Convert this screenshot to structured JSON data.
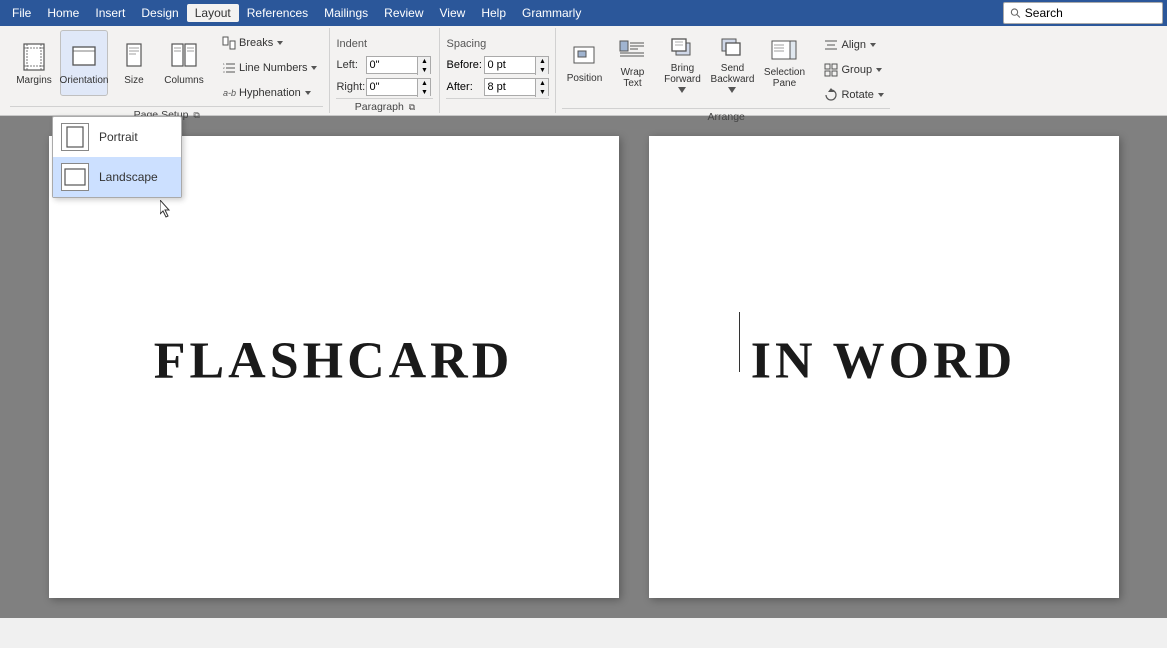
{
  "menubar": {
    "items": [
      "File",
      "Home",
      "Insert",
      "Design",
      "Layout",
      "References",
      "Mailings",
      "Review",
      "View",
      "Help",
      "Grammarly"
    ],
    "active": "Layout",
    "search_placeholder": "Search"
  },
  "ribbon": {
    "groups": [
      {
        "name": "Page Setup",
        "buttons": [
          {
            "id": "margins",
            "label": "Margins",
            "icon": "margins-icon"
          },
          {
            "id": "orientation",
            "label": "Orientation",
            "icon": "orientation-icon"
          },
          {
            "id": "size",
            "label": "Size",
            "icon": "size-icon"
          },
          {
            "id": "columns",
            "label": "Columns",
            "icon": "columns-icon"
          }
        ],
        "small_buttons": [
          {
            "id": "breaks",
            "label": "Breaks",
            "arrow": true
          },
          {
            "id": "line-numbers",
            "label": "Line Numbers",
            "arrow": true
          },
          {
            "id": "hyphenation",
            "label": "Hyphenation",
            "arrow": true
          }
        ]
      },
      {
        "name": "Indent",
        "fields": [
          {
            "label": "Left:",
            "value": "0\""
          },
          {
            "label": "Right:",
            "value": "0\""
          }
        ]
      },
      {
        "name": "Spacing",
        "fields": [
          {
            "label": "Before:",
            "value": "0 pt"
          },
          {
            "label": "After:",
            "value": "8 pt"
          }
        ]
      },
      {
        "name": "Arrange",
        "buttons": [
          {
            "id": "position",
            "label": "Position",
            "icon": "position-icon"
          },
          {
            "id": "wrap-text",
            "label": "Wrap\nText",
            "icon": "wrap-text-icon"
          },
          {
            "id": "bring-forward",
            "label": "Bring\nForward",
            "icon": "bring-forward-icon",
            "arrow": true
          },
          {
            "id": "send-backward",
            "label": "Send\nBackward",
            "icon": "send-backward-icon",
            "arrow": true
          },
          {
            "id": "selection-pane",
            "label": "Selection\nPane",
            "icon": "selection-pane-icon"
          }
        ],
        "right_buttons": [
          {
            "id": "align",
            "label": "Align",
            "arrow": true
          },
          {
            "id": "group",
            "label": "Group",
            "arrow": true
          },
          {
            "id": "rotate",
            "label": "Rotate",
            "arrow": true
          }
        ]
      }
    ]
  },
  "orientation_dropdown": {
    "items": [
      {
        "id": "portrait",
        "label": "Portrait"
      },
      {
        "id": "landscape",
        "label": "Landscape",
        "selected": true
      }
    ]
  },
  "pages": [
    {
      "id": "left",
      "text": "FLASHCARD"
    },
    {
      "id": "right",
      "text": "IN WORD"
    }
  ],
  "indent": {
    "left_label": "Left:",
    "left_value": "0\"",
    "right_label": "Right:",
    "right_value": "0\""
  },
  "spacing": {
    "before_label": "Before:",
    "before_value": "0 pt",
    "after_label": "After:",
    "after_value": "8 pt"
  }
}
